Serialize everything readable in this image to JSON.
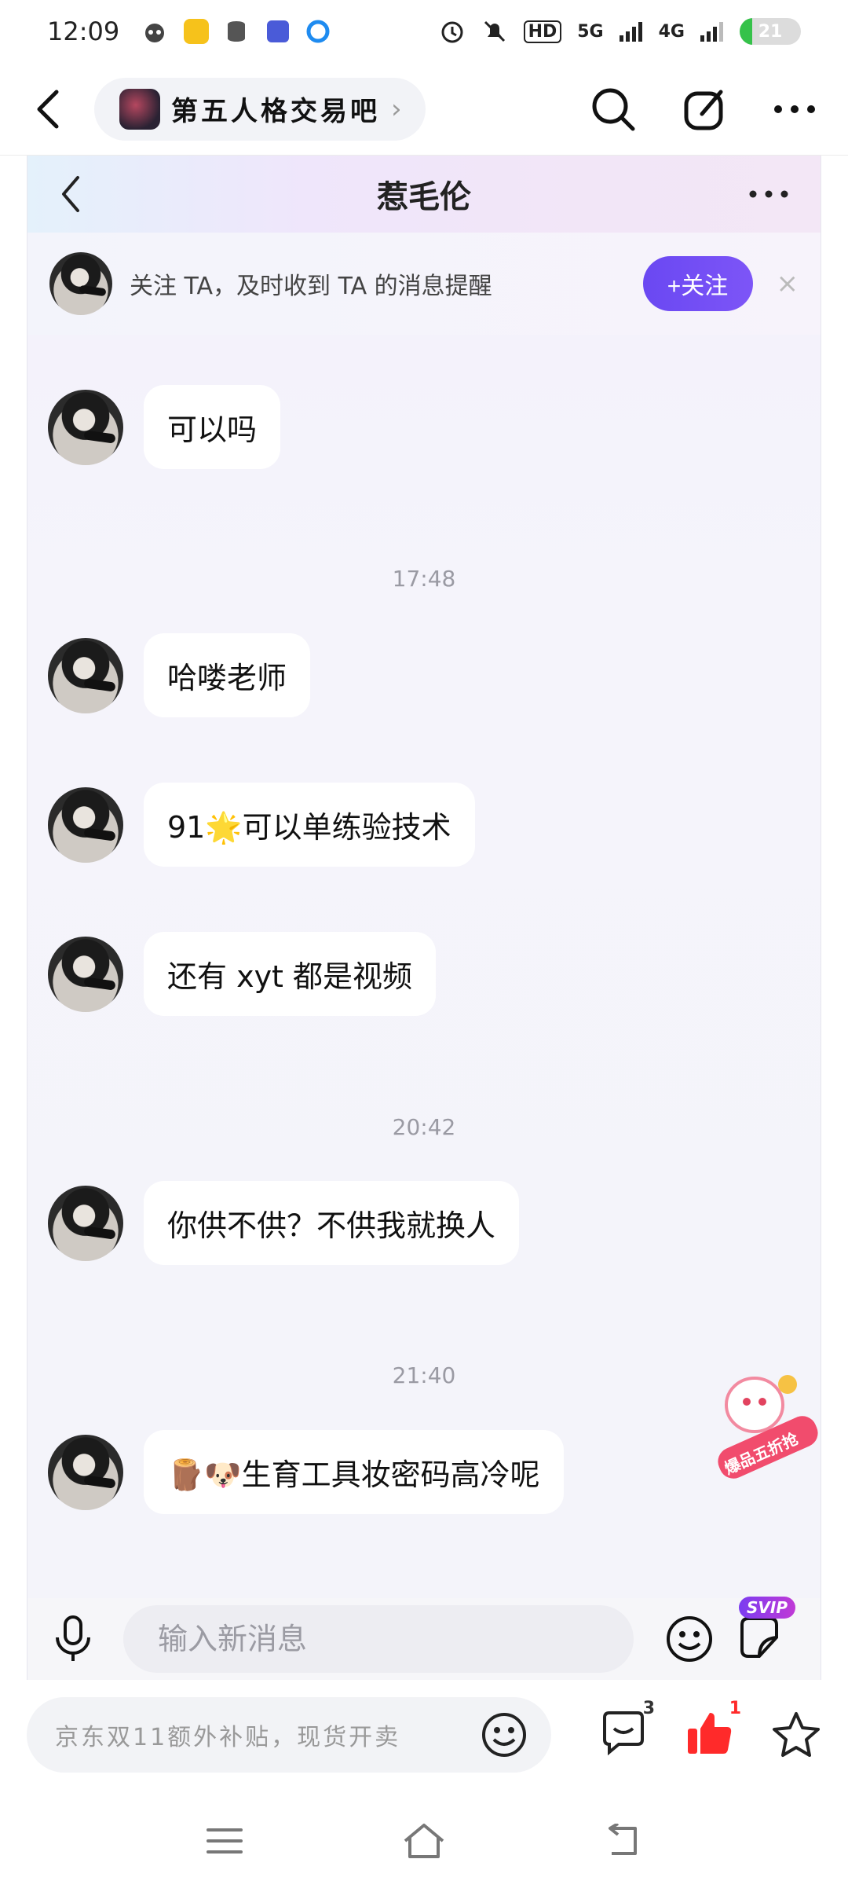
{
  "status_bar": {
    "time": "12:09",
    "battery_level": "21",
    "hd_label": "HD",
    "signal_5g": "5G",
    "signal_4g": "4G"
  },
  "app_bar": {
    "forum_name": "第五人格交易吧",
    "chevron": "›"
  },
  "chat": {
    "title": "惹毛伦",
    "follow_prompt": "关注 TA，及时收到 TA 的消息提醒",
    "follow_button": "+关注",
    "close": "×",
    "messages": [
      {
        "text": "可以吗"
      },
      {
        "timestamp": "17:48"
      },
      {
        "text": "哈喽老师"
      },
      {
        "text": "91🌟可以单练验技术"
      },
      {
        "text": "还有 xyt 都是视频"
      },
      {
        "timestamp": "20:42"
      },
      {
        "text": "你供不供？不供我就换人"
      },
      {
        "timestamp": "21:40"
      },
      {
        "text": "🪵🐶生育工具妆密码高冷呢"
      }
    ],
    "input_placeholder": "输入新消息",
    "svip_label": "SVIP",
    "promo_text": "爆品五折抢"
  },
  "comment_bar": {
    "placeholder": "京东双11额外补贴，现货开卖",
    "comment_count": "3",
    "like_count": "1"
  },
  "colors": {
    "accent_purple": "#6a48f2",
    "like_red": "#ff2a2a",
    "battery_green": "#35c24a"
  }
}
